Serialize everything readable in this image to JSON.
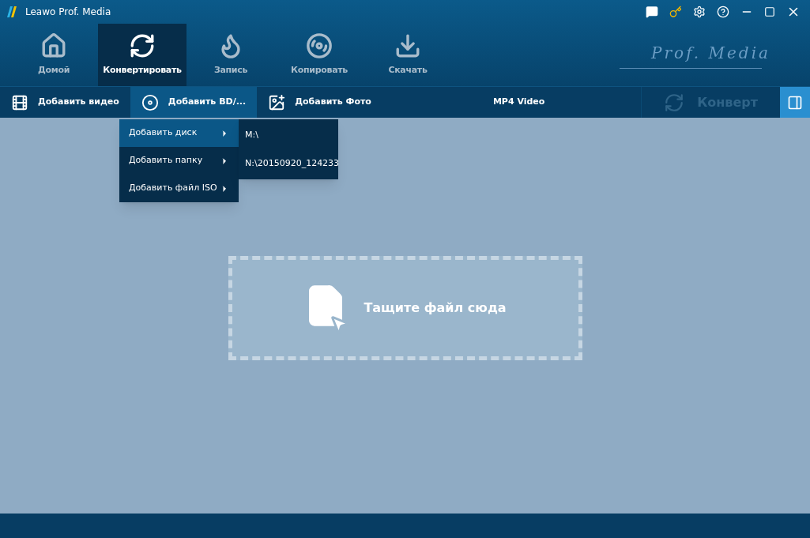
{
  "window": {
    "title": "Leawo Prof. Media"
  },
  "nav": [
    {
      "kind": "home",
      "label": "Домой",
      "selected": false
    },
    {
      "kind": "convert",
      "label": "Конвертировать",
      "selected": true
    },
    {
      "kind": "burn",
      "label": "Запись",
      "selected": false
    },
    {
      "kind": "copy",
      "label": "Копировать",
      "selected": false
    },
    {
      "kind": "download",
      "label": "Скачать",
      "selected": false
    }
  ],
  "brand": "Prof. Media",
  "toolbar": {
    "items": [
      {
        "kind": "video",
        "label": "Добавить видео",
        "selected": false
      },
      {
        "kind": "disc",
        "label": "Добавить BD/...",
        "selected": true
      },
      {
        "kind": "photo",
        "label": "Добавить Фото",
        "selected": false
      }
    ],
    "profile": "MP4 Video",
    "convert": {
      "label": "Конверт",
      "disabled": true
    }
  },
  "menu": [
    {
      "label": "Добавить диск",
      "selected": true
    },
    {
      "label": "Добавить папку",
      "selected": false
    },
    {
      "label": "Добавить файл ISO",
      "selected": false
    }
  ],
  "submenu": [
    "M:\\",
    "N:\\20150920_124233"
  ],
  "dropzone": {
    "text": "Тащите файл сюда"
  }
}
